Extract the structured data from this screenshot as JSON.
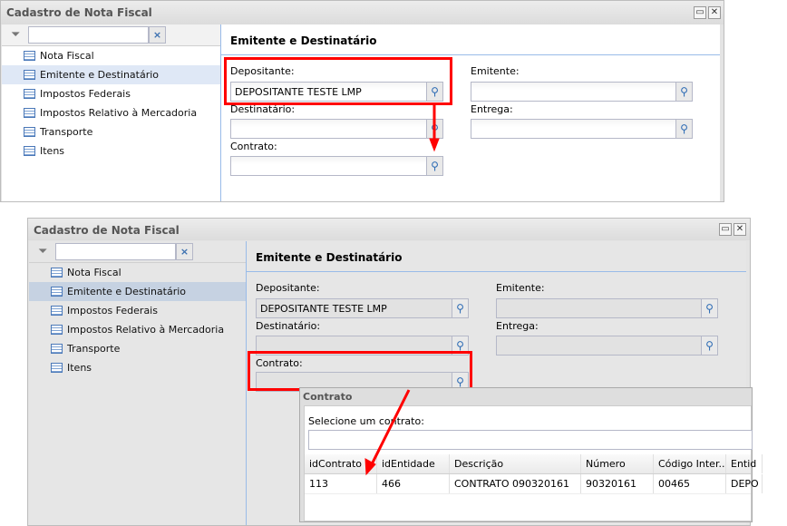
{
  "window_title": "Cadastro de Nota Fiscal",
  "sidebar": {
    "items": [
      {
        "label": "Nota Fiscal"
      },
      {
        "label": "Emitente e Destinatário"
      },
      {
        "label": "Impostos Federais"
      },
      {
        "label": "Impostos Relativo à Mercadoria"
      },
      {
        "label": "Transporte"
      },
      {
        "label": "Itens"
      }
    ],
    "selected": 1
  },
  "content": {
    "title": "Emitente e Destinatário",
    "fields": {
      "depositante_label": "Depositante:",
      "depositante_value": "DEPOSITANTE TESTE LMP",
      "emitente_label": "Emitente:",
      "destinatario_label": "Destinatário:",
      "entrega_label": "Entrega:",
      "contrato_label": "Contrato:"
    }
  },
  "modal": {
    "title": "Contrato",
    "select_label": "Selecione um contrato:",
    "columns": [
      "idContrato",
      "idEntidade",
      "Descrição",
      "Número",
      "Código Inter...",
      "Entid"
    ],
    "rows": [
      [
        "113",
        "466",
        "CONTRATO 090320161",
        "90320161",
        "00465",
        "DEPO"
      ]
    ]
  },
  "colors": {
    "highlight": "#ff0000",
    "selected": "#dfe8f6"
  }
}
